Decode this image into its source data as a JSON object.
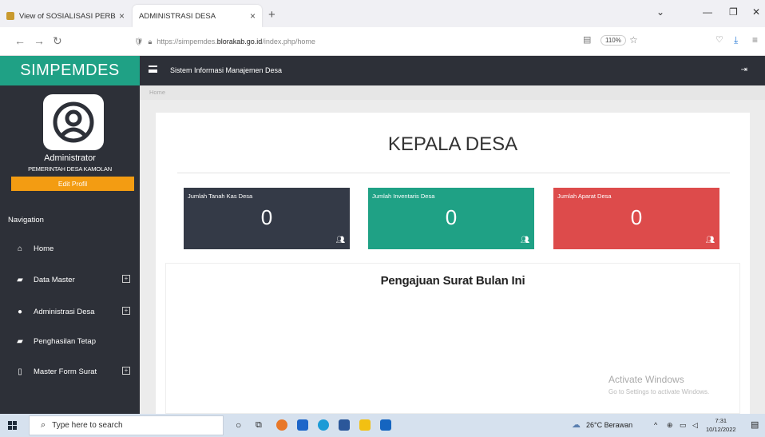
{
  "browser": {
    "tabs": [
      {
        "title": "View of SOSIALISASI PERBANK",
        "active": false
      },
      {
        "title": "ADMINISTRASI DESA",
        "active": true
      }
    ],
    "url_prefix": "https://simpemdes.",
    "url_host": "blorakab.go.id",
    "url_path": "/index.php/home",
    "zoom": "110%"
  },
  "sidebar": {
    "brand": "SIMPEMDES",
    "user_name": "Administrator",
    "user_org": "PEMERINTAH DESA KAMOLAN",
    "edit_label": "Edit Profil",
    "nav_heading": "Navigation",
    "items": [
      {
        "label": "Home",
        "icon": "home-icon",
        "expandable": false
      },
      {
        "label": "Data Master",
        "icon": "book-icon",
        "expandable": true
      },
      {
        "label": "Administrasi Desa",
        "icon": "user-icon",
        "expandable": true
      },
      {
        "label": "Penghasilan Tetap",
        "icon": "book-icon",
        "expandable": false
      },
      {
        "label": "Master Form Surat",
        "icon": "file-icon",
        "expandable": true
      }
    ]
  },
  "header": {
    "system_title": "Sistem Informasi Manajemen Desa"
  },
  "breadcrumb": "Home",
  "main": {
    "page_title": "KEPALA DESA",
    "stats": [
      {
        "label": "Jumlah Tanah Kas Desa",
        "value": "0",
        "color": "#343a47"
      },
      {
        "label": "Jumlah Inventaris Desa",
        "value": "0",
        "color": "#1fa185"
      },
      {
        "label": "Jumlah Aparat Desa",
        "value": "0",
        "color": "#dd4b4b"
      }
    ],
    "surat_title": "Pengajuan Surat Bulan Ini"
  },
  "watermark": {
    "line1": "Activate Windows",
    "line2": "Go to Settings to activate Windows."
  },
  "taskbar": {
    "search_placeholder": "Type here to search",
    "weather": "26°C  Berawan",
    "time": "7:31",
    "date": "10/12/2022"
  }
}
